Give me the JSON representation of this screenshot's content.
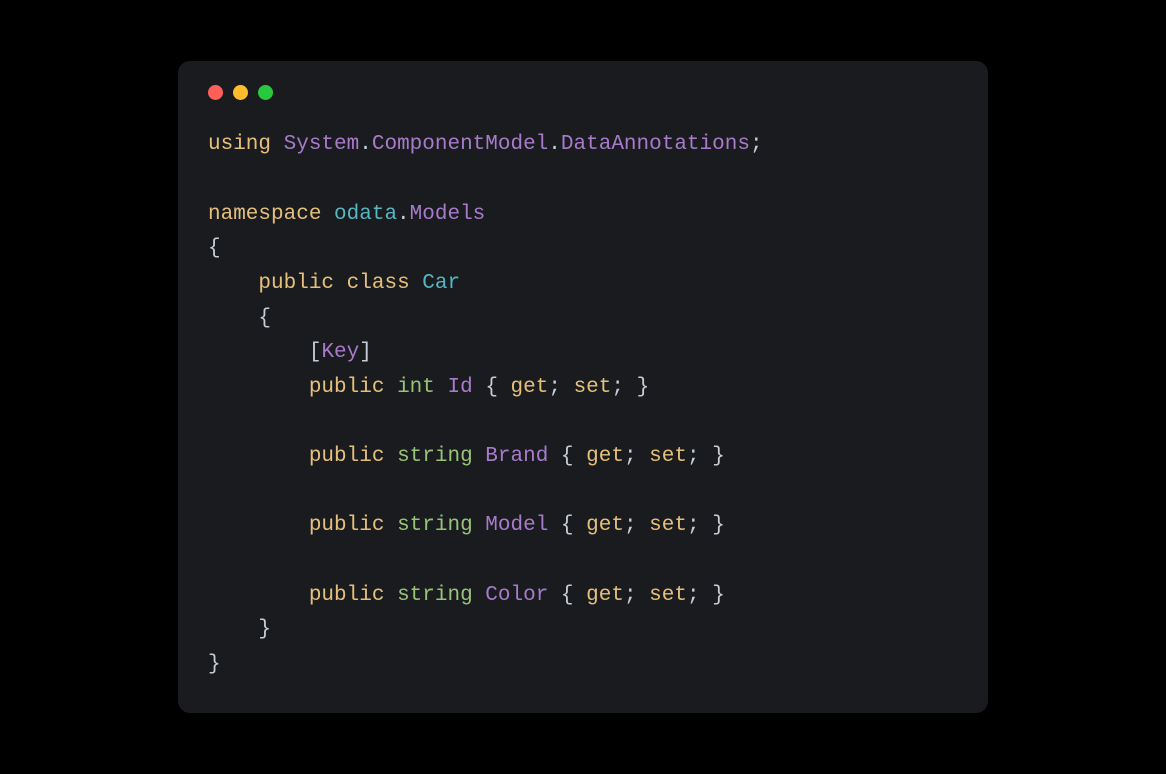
{
  "window": {
    "dots": [
      "red",
      "yellow",
      "green"
    ]
  },
  "code": {
    "tokens": [
      [
        {
          "text": "using",
          "class": "tok-keyword"
        },
        {
          "text": " ",
          "class": ""
        },
        {
          "text": "System",
          "class": "tok-namespace"
        },
        {
          "text": ".",
          "class": "tok-dot"
        },
        {
          "text": "ComponentModel",
          "class": "tok-namespace"
        },
        {
          "text": ".",
          "class": "tok-dot"
        },
        {
          "text": "DataAnnotations",
          "class": "tok-namespace"
        },
        {
          "text": ";",
          "class": "tok-punc"
        }
      ],
      [],
      [
        {
          "text": "namespace",
          "class": "tok-keyword"
        },
        {
          "text": " ",
          "class": ""
        },
        {
          "text": "odata",
          "class": "tok-ns-ident"
        },
        {
          "text": ".",
          "class": "tok-dot"
        },
        {
          "text": "Models",
          "class": "tok-namespace"
        }
      ],
      [
        {
          "text": "{",
          "class": "tok-bracket"
        }
      ],
      [
        {
          "text": "    ",
          "class": ""
        },
        {
          "text": "public",
          "class": "tok-keyword"
        },
        {
          "text": " ",
          "class": ""
        },
        {
          "text": "class",
          "class": "tok-keyword"
        },
        {
          "text": " ",
          "class": ""
        },
        {
          "text": "Car",
          "class": "tok-classname"
        }
      ],
      [
        {
          "text": "    ",
          "class": ""
        },
        {
          "text": "{",
          "class": "tok-bracket"
        }
      ],
      [
        {
          "text": "        ",
          "class": ""
        },
        {
          "text": "[",
          "class": "tok-bracket"
        },
        {
          "text": "Key",
          "class": "tok-attribute"
        },
        {
          "text": "]",
          "class": "tok-bracket"
        }
      ],
      [
        {
          "text": "        ",
          "class": ""
        },
        {
          "text": "public",
          "class": "tok-keyword"
        },
        {
          "text": " ",
          "class": ""
        },
        {
          "text": "int",
          "class": "tok-type"
        },
        {
          "text": " ",
          "class": ""
        },
        {
          "text": "Id",
          "class": "tok-namespace"
        },
        {
          "text": " ",
          "class": ""
        },
        {
          "text": "{",
          "class": "tok-bracket"
        },
        {
          "text": " ",
          "class": ""
        },
        {
          "text": "get",
          "class": "tok-keyword"
        },
        {
          "text": ";",
          "class": "tok-punc"
        },
        {
          "text": " ",
          "class": ""
        },
        {
          "text": "set",
          "class": "tok-keyword"
        },
        {
          "text": ";",
          "class": "tok-punc"
        },
        {
          "text": " ",
          "class": ""
        },
        {
          "text": "}",
          "class": "tok-bracket"
        }
      ],
      [],
      [
        {
          "text": "        ",
          "class": ""
        },
        {
          "text": "public",
          "class": "tok-keyword"
        },
        {
          "text": " ",
          "class": ""
        },
        {
          "text": "string",
          "class": "tok-type"
        },
        {
          "text": " ",
          "class": ""
        },
        {
          "text": "Brand",
          "class": "tok-namespace"
        },
        {
          "text": " ",
          "class": ""
        },
        {
          "text": "{",
          "class": "tok-bracket"
        },
        {
          "text": " ",
          "class": ""
        },
        {
          "text": "get",
          "class": "tok-keyword"
        },
        {
          "text": ";",
          "class": "tok-punc"
        },
        {
          "text": " ",
          "class": ""
        },
        {
          "text": "set",
          "class": "tok-keyword"
        },
        {
          "text": ";",
          "class": "tok-punc"
        },
        {
          "text": " ",
          "class": ""
        },
        {
          "text": "}",
          "class": "tok-bracket"
        }
      ],
      [],
      [
        {
          "text": "        ",
          "class": ""
        },
        {
          "text": "public",
          "class": "tok-keyword"
        },
        {
          "text": " ",
          "class": ""
        },
        {
          "text": "string",
          "class": "tok-type"
        },
        {
          "text": " ",
          "class": ""
        },
        {
          "text": "Model",
          "class": "tok-namespace"
        },
        {
          "text": " ",
          "class": ""
        },
        {
          "text": "{",
          "class": "tok-bracket"
        },
        {
          "text": " ",
          "class": ""
        },
        {
          "text": "get",
          "class": "tok-keyword"
        },
        {
          "text": ";",
          "class": "tok-punc"
        },
        {
          "text": " ",
          "class": ""
        },
        {
          "text": "set",
          "class": "tok-keyword"
        },
        {
          "text": ";",
          "class": "tok-punc"
        },
        {
          "text": " ",
          "class": ""
        },
        {
          "text": "}",
          "class": "tok-bracket"
        }
      ],
      [],
      [
        {
          "text": "        ",
          "class": ""
        },
        {
          "text": "public",
          "class": "tok-keyword"
        },
        {
          "text": " ",
          "class": ""
        },
        {
          "text": "string",
          "class": "tok-type"
        },
        {
          "text": " ",
          "class": ""
        },
        {
          "text": "Color",
          "class": "tok-namespace"
        },
        {
          "text": " ",
          "class": ""
        },
        {
          "text": "{",
          "class": "tok-bracket"
        },
        {
          "text": " ",
          "class": ""
        },
        {
          "text": "get",
          "class": "tok-keyword"
        },
        {
          "text": ";",
          "class": "tok-punc"
        },
        {
          "text": " ",
          "class": ""
        },
        {
          "text": "set",
          "class": "tok-keyword"
        },
        {
          "text": ";",
          "class": "tok-punc"
        },
        {
          "text": " ",
          "class": ""
        },
        {
          "text": "}",
          "class": "tok-bracket"
        }
      ],
      [
        {
          "text": "    ",
          "class": ""
        },
        {
          "text": "}",
          "class": "tok-bracket"
        }
      ],
      [
        {
          "text": "}",
          "class": "tok-bracket"
        }
      ]
    ]
  }
}
